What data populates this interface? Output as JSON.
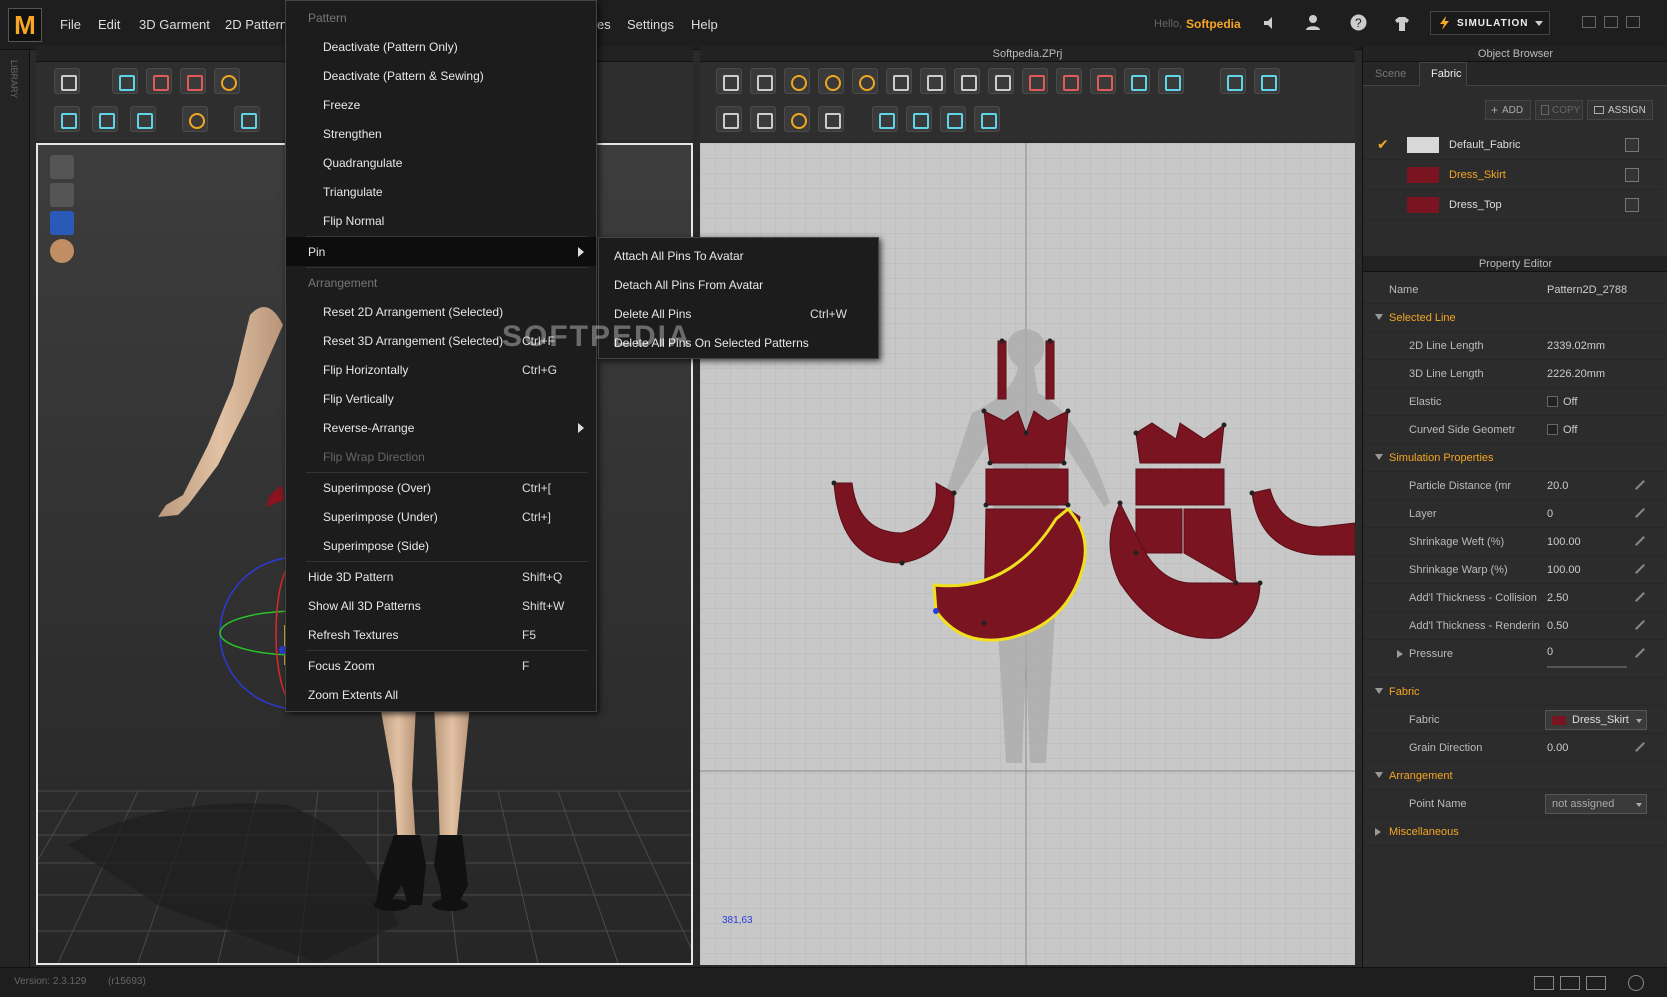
{
  "app": {
    "logo_letter": "M",
    "greeting": "Hello,",
    "user": "Softpedia",
    "mode": "SIMULATION"
  },
  "menubar": {
    "items": [
      "File",
      "Edit",
      "3D Garment",
      "2D Pattern",
      "es",
      "Settings",
      "Help"
    ]
  },
  "panels": {
    "view2d_title": "Softpedia.ZPrj",
    "library_tab": "LIBRARY",
    "object_browser_title": "Object Browser",
    "property_editor_title": "Property Editor"
  },
  "object_browser": {
    "tabs": [
      "Scene",
      "Fabric"
    ],
    "active_tab": "Fabric",
    "buttons": {
      "add": "ADD",
      "copy": "COPY",
      "assign": "ASSIGN"
    },
    "fabrics": [
      {
        "name": "Default_Fabric",
        "color": "#d8d8d8",
        "checked": true
      },
      {
        "name": "Dress_Skirt",
        "color": "#7a1420",
        "checked": false,
        "highlight": true
      },
      {
        "name": "Dress_Top",
        "color": "#7a1420",
        "checked": false
      }
    ]
  },
  "property_editor": {
    "name_label": "Name",
    "name_value": "Pattern2D_2788",
    "sections": {
      "selected_line": "Selected Line",
      "simulation": "Simulation Properties",
      "fabric": "Fabric",
      "arrangement": "Arrangement",
      "misc": "Miscellaneous"
    },
    "rows": {
      "line2d": {
        "label": "2D Line Length",
        "value": "2339.02mm"
      },
      "line3d": {
        "label": "3D Line Length",
        "value": "2226.20mm"
      },
      "elastic": {
        "label": "Elastic",
        "value": "Off"
      },
      "curved": {
        "label": "Curved Side Geometr",
        "value": "Off"
      },
      "particle": {
        "label": "Particle Distance (mr",
        "value": "20.0"
      },
      "layer": {
        "label": "Layer",
        "value": "0"
      },
      "weft": {
        "label": "Shrinkage Weft (%)",
        "value": "100.00"
      },
      "warp": {
        "label": "Shrinkage Warp (%)",
        "value": "100.00"
      },
      "th_col": {
        "label": "Add'l Thickness - Collision",
        "value": "2.50"
      },
      "th_ren": {
        "label": "Add'l Thickness - Renderin",
        "value": "0.50"
      },
      "pressure": {
        "label": "Pressure",
        "value": "0"
      },
      "fabric": {
        "label": "Fabric",
        "value": "Dress_Skirt"
      },
      "grain": {
        "label": "Grain Direction",
        "value": "0.00"
      },
      "point": {
        "label": "Point Name",
        "value": "not assigned"
      }
    }
  },
  "context_menu": {
    "pattern_header": "Pattern",
    "items": [
      {
        "label": "Deactivate (Pattern Only)"
      },
      {
        "label": "Deactivate (Pattern & Sewing)"
      },
      {
        "label": "Freeze"
      },
      {
        "label": "Strengthen"
      },
      {
        "label": "Quadrangulate"
      },
      {
        "label": "Triangulate"
      },
      {
        "label": "Flip Normal"
      }
    ],
    "pin_label": "Pin",
    "arrangement_header": "Arrangement",
    "arrangement_items": [
      {
        "label": "Reset 2D Arrangement (Selected)",
        "shortcut": ""
      },
      {
        "label": "Reset 3D Arrangement (Selected)",
        "shortcut": "Ctrl+F"
      },
      {
        "label": "Flip Horizontally",
        "shortcut": "Ctrl+G"
      },
      {
        "label": "Flip Vertically",
        "shortcut": ""
      },
      {
        "label": "Reverse-Arrange",
        "shortcut": ""
      },
      {
        "label": "Flip Wrap Direction",
        "shortcut": ""
      }
    ],
    "superimpose_items": [
      {
        "label": "Superimpose (Over)",
        "shortcut": "Ctrl+["
      },
      {
        "label": "Superimpose (Under)",
        "shortcut": "Ctrl+]"
      },
      {
        "label": "Superimpose (Side)",
        "shortcut": ""
      }
    ],
    "view_items": [
      {
        "label": "Hide 3D Pattern",
        "shortcut": "Shift+Q"
      },
      {
        "label": "Show All 3D Patterns",
        "shortcut": "Shift+W"
      },
      {
        "label": "Refresh Textures",
        "shortcut": "F5"
      }
    ],
    "zoom_items": [
      {
        "label": "Focus Zoom",
        "shortcut": "F"
      },
      {
        "label": "Zoom Extents All",
        "shortcut": ""
      }
    ]
  },
  "pin_submenu": [
    {
      "label": "Attach All Pins To Avatar",
      "shortcut": ""
    },
    {
      "label": "Detach All Pins From Avatar",
      "shortcut": ""
    },
    {
      "label": "Delete All Pins",
      "shortcut": "Ctrl+W"
    },
    {
      "label": "Delete All Pins On Selected Patterns",
      "shortcut": ""
    }
  ],
  "view2d": {
    "coords": "381,63"
  },
  "status": {
    "version": "Version: 2.3.129",
    "build": "(r15693)"
  },
  "watermark": "SOFTPEDIA",
  "colors": {
    "accent": "#f5a623",
    "fabric": "#7a1420",
    "selection": "#f0e020"
  }
}
